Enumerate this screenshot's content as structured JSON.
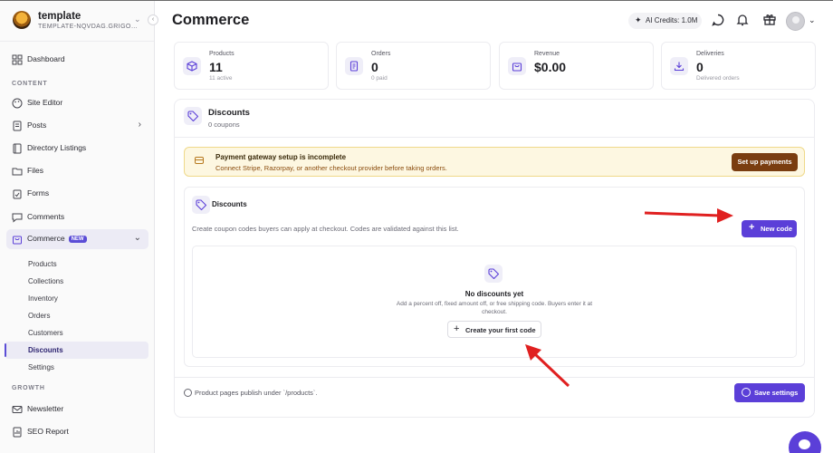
{
  "brand": {
    "name": "template",
    "sub": "TEMPLATE-NQVDAG.GRIGOR..."
  },
  "sidebar": {
    "dashboard": "Dashboard",
    "section_content": "CONTENT",
    "site_editor": "Site Editor",
    "posts": "Posts",
    "directory": "Directory Listings",
    "files": "Files",
    "forms": "Forms",
    "comments": "Comments",
    "commerce": "Commerce",
    "commerce_badge": "NEW",
    "sub": [
      "Products",
      "Collections",
      "Inventory",
      "Orders",
      "Customers",
      "Discounts",
      "Settings"
    ],
    "section_growth": "GROWTH",
    "newsletter": "Newsletter",
    "seo": "SEO Report"
  },
  "header": {
    "title": "Commerce",
    "credits": "AI Credits: 1.0M"
  },
  "stats": [
    {
      "label": "Products",
      "value": "11",
      "sub": "11 active",
      "icon": "cube-icon"
    },
    {
      "label": "Orders",
      "value": "0",
      "sub": "0 paid",
      "icon": "receipt-icon"
    },
    {
      "label": "Revenue",
      "value": "$0.00",
      "sub": "",
      "icon": "bag-icon"
    },
    {
      "label": "Deliveries",
      "value": "0",
      "sub": "Delivered orders",
      "icon": "download-icon"
    }
  ],
  "panel": {
    "title": "Discounts",
    "subtitle": "0 coupons"
  },
  "alert": {
    "title": "Payment gateway setup is incomplete",
    "desc": "Connect Stripe, Razorpay, or another checkout provider before taking orders.",
    "button": "Set up payments"
  },
  "discounts": {
    "title": "Discounts",
    "desc": "Create coupon codes buyers can apply at checkout. Codes are validated against this list.",
    "new_button": "New code",
    "empty_title": "No discounts yet",
    "empty_desc": "Add a percent off, fixed amount off, or free shipping code. Buyers enter it at checkout.",
    "first_button": "Create your first code"
  },
  "footer": {
    "note": "Product pages publish under `/products`.",
    "save": "Save settings"
  },
  "colors": {
    "accent": "#5b3fd8",
    "alert_bg": "#fdf7e1",
    "alert_btn": "#7a3d10",
    "annotation": "#e02020"
  }
}
